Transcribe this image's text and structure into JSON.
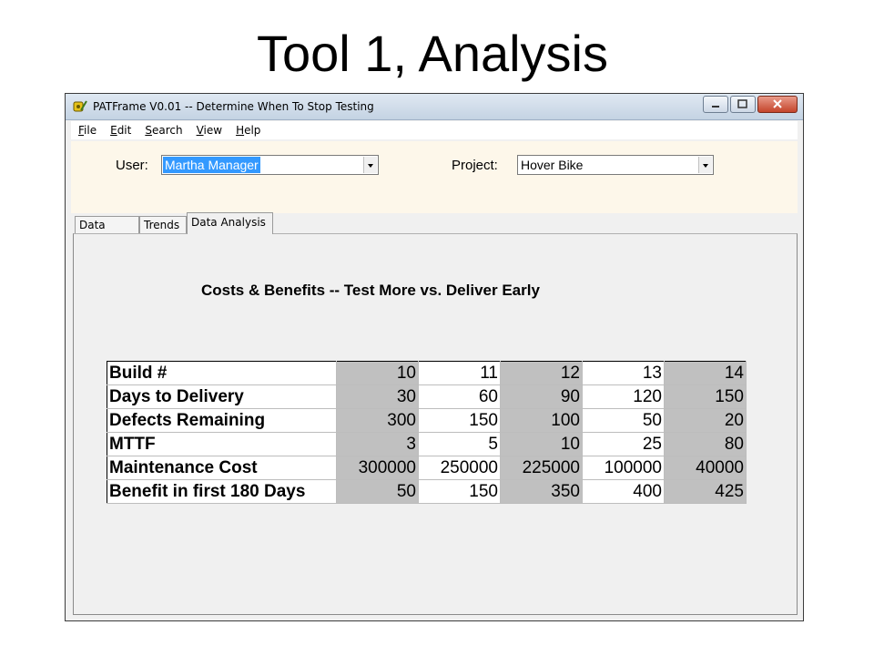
{
  "slide": {
    "title": "Tool 1, Analysis"
  },
  "window": {
    "title": "PATFrame V0.01 -- Determine When To Stop Testing",
    "icon": "tape-measure-icon"
  },
  "menu": [
    {
      "accel": "F",
      "rest": "ile"
    },
    {
      "accel": "E",
      "rest": "dit"
    },
    {
      "accel": "S",
      "rest": "earch"
    },
    {
      "accel": "V",
      "rest": "iew"
    },
    {
      "accel": "H",
      "rest": "elp"
    }
  ],
  "header": {
    "user_label": "User:",
    "user_value": "Martha Manager",
    "project_label": "Project:",
    "project_value": "Hover Bike"
  },
  "tabs": [
    "Data Input",
    "Trends",
    "Data Analysis"
  ],
  "active_tab": "Data Analysis",
  "analysis": {
    "title": "Costs & Benefits -- Test More vs. Deliver Early",
    "rows": [
      {
        "label": "Build #",
        "values": [
          "10",
          "11",
          "12",
          "13",
          "14"
        ]
      },
      {
        "label": "Days to Delivery",
        "values": [
          "30",
          "60",
          "90",
          "120",
          "150"
        ]
      },
      {
        "label": "Defects Remaining",
        "values": [
          "300",
          "150",
          "100",
          "50",
          "20"
        ]
      },
      {
        "label": "MTTF",
        "values": [
          "3",
          "5",
          "10",
          "25",
          "80"
        ]
      },
      {
        "label": "Maintenance Cost",
        "values": [
          "300000",
          "250000",
          "225000",
          "100000",
          "40000"
        ]
      },
      {
        "label": "Benefit in first 180 Days",
        "values": [
          "50",
          "150",
          "350",
          "400",
          "425"
        ]
      }
    ]
  },
  "colors": {
    "header_bg": "#fdf7ea",
    "shaded_cell": "#c0c0c0",
    "selection": "#3399ff"
  }
}
